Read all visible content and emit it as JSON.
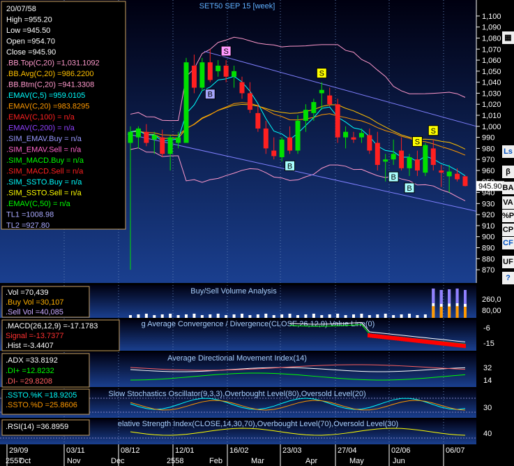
{
  "chart_data": [
    {
      "type": "candlestick",
      "title": "SET50 SEP 15  [week]",
      "ylim": [
        865,
        1105
      ],
      "y_ticks": [
        "1,100",
        "1,090",
        "1,080",
        "1,070",
        "1,060",
        "1,050",
        "1,040",
        "1,030",
        "1,020",
        "1,010",
        "1,000",
        "990",
        "980",
        "970",
        "960",
        "950",
        "940",
        "930",
        "920",
        "910",
        "900",
        "890",
        "880",
        "870"
      ],
      "current_price": "945.90",
      "info_box": [
        {
          "text": "20/07/58",
          "color": "#ffffff"
        },
        {
          "text": "High  =955.20",
          "color": "#ffffff"
        },
        {
          "text": "Low  =945.50",
          "color": "#ffffff"
        },
        {
          "text": "Open  =954.70",
          "color": "#ffffff"
        },
        {
          "text": "Close  =945.90",
          "color": "#ffffff"
        },
        {
          "text": ".BB.Top(C,20)  =1,031.1092",
          "color": "#ff99cc"
        },
        {
          "text": ".BB.Avg(C,20)  =986.2200",
          "color": "#ffc000"
        },
        {
          "text": ".BB.Btm(C,20)  =941.3308",
          "color": "#ff99cc"
        },
        {
          "text": ".EMAV(C,5)  =959.0105",
          "color": "#00ffff"
        },
        {
          "text": ".EMAV(C,20)  =983.8295",
          "color": "#ff9900"
        },
        {
          "text": ".EMAV(C,100)  = n/a",
          "color": "#ff2020"
        },
        {
          "text": ".EMAV(C,200)  = n/a",
          "color": "#9040ff"
        },
        {
          "text": ".SIM_EMAV.Buy  = n/a",
          "color": "#9999ff"
        },
        {
          "text": ".SIM_EMAV.Sell  = n/a",
          "color": "#ff66cc"
        },
        {
          "text": ".SIM_MACD.Buy  = n/a",
          "color": "#00ff00"
        },
        {
          "text": ".SIM_MACD.Sell  = n/a",
          "color": "#ff2020"
        },
        {
          "text": ".SIM_SSTO.Buy  = n/a",
          "color": "#00ffff"
        },
        {
          "text": ".SIM_SSTO.Sell  = n/a",
          "color": "#ffff00"
        },
        {
          "text": ".EMAV(C,50)  = n/a",
          "color": "#00ff00"
        },
        {
          "text": "TL1 =1008.98",
          "color": "#aaaaff"
        },
        {
          "text": "TL2 =927.80",
          "color": "#aaaaff"
        }
      ],
      "candles": [
        {
          "o": 985,
          "h": 1000,
          "l": 870,
          "c": 995
        },
        {
          "o": 990,
          "h": 1000,
          "l": 980,
          "c": 998
        },
        {
          "o": 995,
          "h": 1002,
          "l": 982,
          "c": 985
        },
        {
          "o": 988,
          "h": 995,
          "l": 975,
          "c": 992
        },
        {
          "o": 990,
          "h": 997,
          "l": 972,
          "c": 975
        },
        {
          "o": 975,
          "h": 992,
          "l": 960,
          "c": 990
        },
        {
          "o": 985,
          "h": 995,
          "l": 980,
          "c": 990
        },
        {
          "o": 985,
          "h": 1062,
          "l": 985,
          "c": 1058
        },
        {
          "o": 1055,
          "h": 1065,
          "l": 1030,
          "c": 1035
        },
        {
          "o": 1035,
          "h": 1062,
          "l": 1032,
          "c": 1058
        },
        {
          "o": 1058,
          "h": 1070,
          "l": 1040,
          "c": 1042
        },
        {
          "o": 1050,
          "h": 1060,
          "l": 1045,
          "c": 1055
        },
        {
          "o": 1055,
          "h": 1060,
          "l": 1040,
          "c": 1045
        },
        {
          "o": 1045,
          "h": 1055,
          "l": 1035,
          "c": 1050
        },
        {
          "o": 1040,
          "h": 1045,
          "l": 1025,
          "c": 1030
        },
        {
          "o": 1030,
          "h": 1040,
          "l": 1012,
          "c": 1015
        },
        {
          "o": 1012,
          "h": 1020,
          "l": 995,
          "c": 998
        },
        {
          "o": 998,
          "h": 1005,
          "l": 975,
          "c": 980
        },
        {
          "o": 978,
          "h": 990,
          "l": 970,
          "c": 973
        },
        {
          "o": 972,
          "h": 990,
          "l": 968,
          "c": 988
        },
        {
          "o": 990,
          "h": 1000,
          "l": 975,
          "c": 978
        },
        {
          "o": 978,
          "h": 1010,
          "l": 975,
          "c": 1005
        },
        {
          "o": 1005,
          "h": 1020,
          "l": 995,
          "c": 1015
        },
        {
          "o": 1012,
          "h": 1025,
          "l": 1005,
          "c": 1022
        },
        {
          "o": 1030,
          "h": 1040,
          "l": 1015,
          "c": 1033
        },
        {
          "o": 1028,
          "h": 1035,
          "l": 1018,
          "c": 1020
        },
        {
          "o": 1020,
          "h": 1025,
          "l": 985,
          "c": 990
        },
        {
          "o": 990,
          "h": 1000,
          "l": 980,
          "c": 995
        },
        {
          "o": 990,
          "h": 995,
          "l": 985,
          "c": 988
        },
        {
          "o": 990,
          "h": 998,
          "l": 985,
          "c": 994
        },
        {
          "o": 992,
          "h": 998,
          "l": 975,
          "c": 978
        },
        {
          "o": 985,
          "h": 995,
          "l": 960,
          "c": 965
        },
        {
          "o": 968,
          "h": 975,
          "l": 950,
          "c": 970
        },
        {
          "o": 970,
          "h": 988,
          "l": 965,
          "c": 975
        },
        {
          "o": 978,
          "h": 990,
          "l": 960,
          "c": 962
        },
        {
          "o": 962,
          "h": 975,
          "l": 955,
          "c": 972
        },
        {
          "o": 970,
          "h": 978,
          "l": 955,
          "c": 960
        },
        {
          "o": 958,
          "h": 985,
          "l": 955,
          "c": 983
        },
        {
          "o": 980,
          "h": 988,
          "l": 960,
          "c": 965
        },
        {
          "o": 960,
          "h": 965,
          "l": 945,
          "c": 958
        },
        {
          "o": 954.7,
          "h": 965,
          "l": 940,
          "c": 959
        },
        {
          "o": 957,
          "h": 962,
          "l": 950,
          "c": 952
        },
        {
          "o": 954.7,
          "h": 955.2,
          "l": 945.5,
          "c": 945.9
        }
      ],
      "x_labels_top": [
        "29/09",
        "03/11",
        "08/12",
        "12/01",
        "16/02",
        "23/03",
        "27/04",
        "02/06",
        "06/07"
      ],
      "x_labels_bottom": [
        "2557",
        "Oct",
        "Nov",
        "Dec",
        "2558",
        "Feb",
        "Mar",
        "Apr",
        "May",
        "Jun"
      ],
      "signals": [
        {
          "label": "S",
          "type": "ema-sell",
          "bar": 12
        },
        {
          "label": "B",
          "type": "ema-buy",
          "bar": 10
        },
        {
          "label": "B",
          "type": "ssto-buy",
          "bar": 20
        },
        {
          "label": "S",
          "type": "ssto-sell",
          "bar": 24
        },
        {
          "label": "B",
          "type": "ssto-buy",
          "bar": 33
        },
        {
          "label": "B",
          "type": "ssto-buy",
          "bar": 35
        },
        {
          "label": "S",
          "type": "ssto-sell",
          "bar": 36
        },
        {
          "label": "S",
          "type": "ssto-sell",
          "bar": 38
        }
      ],
      "trendlines": [
        {
          "name": "TL1",
          "value": "1008.98"
        },
        {
          "name": "TL2",
          "value": "927.80"
        }
      ]
    },
    {
      "type": "bar",
      "title": "Buy/Sell Volume Analysis",
      "info": [
        {
          "text": ".Vol   =70,439",
          "color": "#ffffff"
        },
        {
          "text": ".Buy Vol  =30,107",
          "color": "#ffb000"
        },
        {
          "text": ".Sell Vol  =40,085",
          "color": "#c9a8ff"
        }
      ],
      "y_ticks": [
        "260,0",
        "80,00"
      ]
    },
    {
      "type": "line",
      "title": "g Average Convergence / Divergence(CLOSE,26,12,9) Value Line(0)",
      "info": [
        {
          "text": ".MACD(26,12,9)  =-17.1783",
          "color": "#ffffff"
        },
        {
          "text": " Signal  =-13.7377",
          "color": "#ff3030"
        },
        {
          "text": " .Hist  =-3.4407",
          "color": "#ffffff"
        }
      ],
      "y_ticks": [
        "-6",
        "-15"
      ]
    },
    {
      "type": "line",
      "title": "Average Directional Movement Index(14)",
      "info": [
        {
          "text": ".ADX   =33.8192",
          "color": "#ffffff"
        },
        {
          "text": ".DI+   =12.8232",
          "color": "#00ff00"
        },
        {
          "text": ".DI-   =29.8208",
          "color": "#ff6060"
        }
      ],
      "y_ticks": [
        "32",
        "14"
      ]
    },
    {
      "type": "line",
      "title": "Slow Stochastics Oscillator(9,3,3),Overbought Level(80),Oversold Level(20)",
      "info": [
        {
          "text": ".SSTO.%K  =18.9205",
          "color": "#00ffff"
        },
        {
          "text": " .SSTO.%D  =25.8606",
          "color": "#ff9900"
        }
      ],
      "y_ticks": [
        "30"
      ]
    },
    {
      "type": "line",
      "title": "elative Strength Index(CLOSE,14,30,70),Overbought Level(70),Oversold Level(30)",
      "info": [
        {
          "text": ".RSI(14)  =36.8959",
          "color": "#ffffff"
        }
      ],
      "y_ticks": [
        "40"
      ]
    }
  ],
  "right_toolbar": [
    {
      "icon": "chart-type-icon",
      "label": ""
    },
    {
      "icon": "ls",
      "label": "Ls"
    },
    {
      "icon": "beta",
      "label": "β"
    },
    {
      "icon": "ba",
      "label": "BA"
    },
    {
      "icon": "va",
      "label": "VA"
    },
    {
      "icon": "pp",
      "label": "%P"
    },
    {
      "icon": "cp",
      "label": "CP"
    },
    {
      "icon": "cf",
      "label": "CF"
    },
    {
      "icon": "uf",
      "label": "UF"
    },
    {
      "icon": "help-icon",
      "label": "?"
    }
  ]
}
